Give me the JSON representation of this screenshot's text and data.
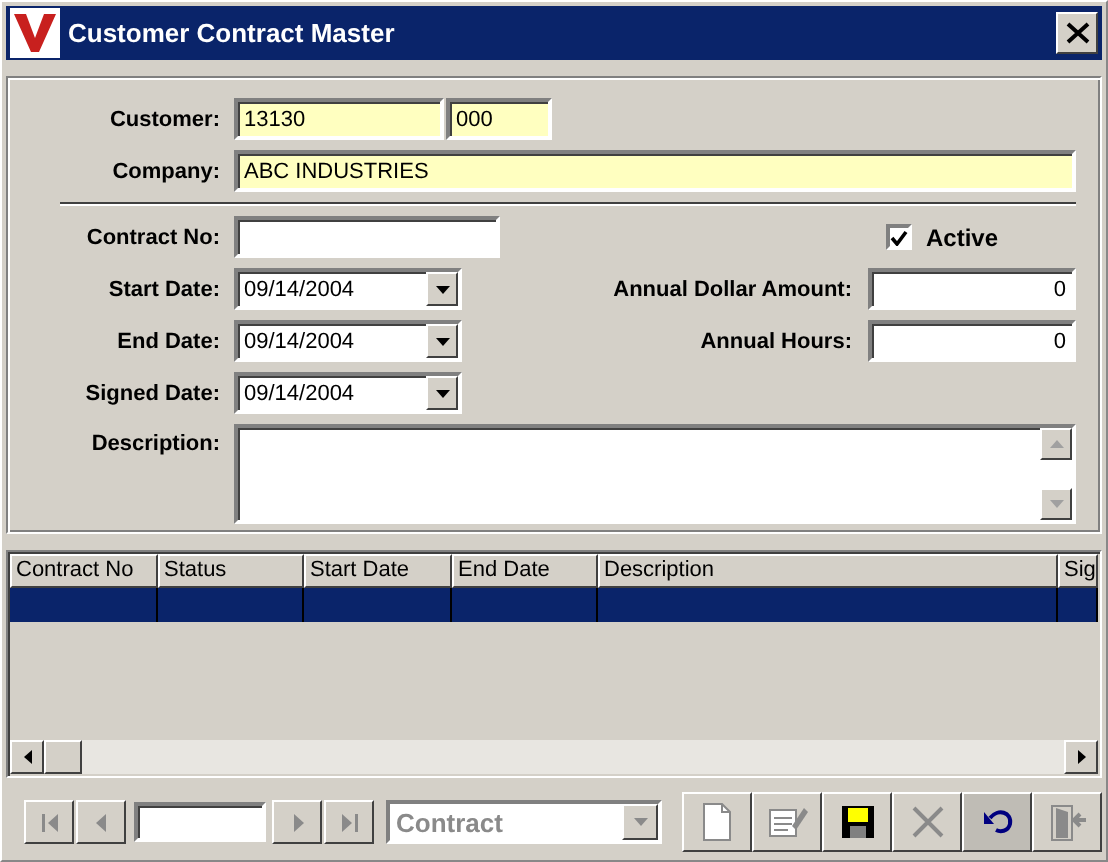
{
  "window": {
    "title": "Customer Contract Master"
  },
  "customer": {
    "label": "Customer:",
    "number": "13130",
    "suffix": "000"
  },
  "company": {
    "label": "Company:",
    "value": "ABC INDUSTRIES"
  },
  "contract_no": {
    "label": "Contract No:"
  },
  "active": {
    "label": "Active",
    "checked": true
  },
  "dates": [
    {
      "label": "Start Date:",
      "value": "09/14/2004"
    },
    {
      "label": "End Date:",
      "value": "09/14/2004"
    },
    {
      "label": "Signed Date:",
      "value": "09/14/2004"
    }
  ],
  "amounts": [
    {
      "label": "Annual Dollar Amount:",
      "value": "0"
    },
    {
      "label": "Annual Hours:",
      "value": "0"
    }
  ],
  "description": {
    "label": "Description:"
  },
  "table": {
    "columns": [
      "Contract No",
      "Status",
      "Start Date",
      "End Date",
      "Description",
      "Sig"
    ],
    "rows": [
      {
        "selected": true
      }
    ]
  },
  "navigator": {
    "buttons": [
      {
        "kind": "first",
        "disabled": true
      },
      {
        "kind": "prev",
        "disabled": true
      },
      {
        "kind": "next",
        "disabled": true
      },
      {
        "kind": "last",
        "disabled": true
      }
    ],
    "combo": {
      "value": "Contract",
      "disabled": true
    }
  },
  "toolbar": [
    {
      "kind": "new",
      "disabled": true,
      "pressed": false
    },
    {
      "kind": "edit",
      "disabled": true,
      "pressed": false
    },
    {
      "kind": "save",
      "disabled": false,
      "pressed": false
    },
    {
      "kind": "delete",
      "disabled": true,
      "pressed": false
    },
    {
      "kind": "undo",
      "disabled": false,
      "pressed": true
    },
    {
      "kind": "exit",
      "disabled": true,
      "pressed": false
    }
  ]
}
